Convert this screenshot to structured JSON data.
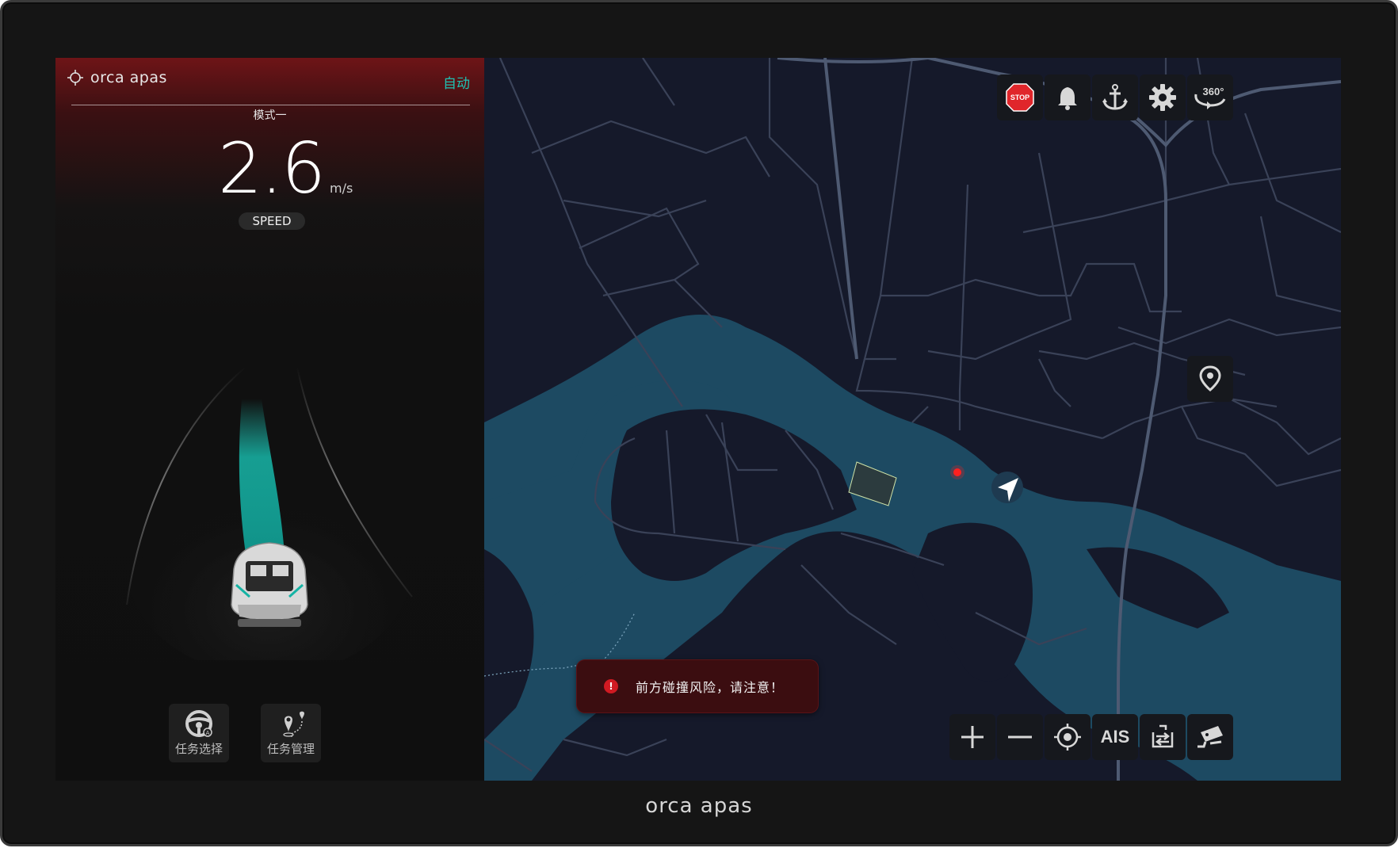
{
  "app": {
    "brand": "orca apas"
  },
  "status": {
    "drive_mode": "自动",
    "mode_name": "模式一"
  },
  "speed": {
    "value": "2.6",
    "unit": "m/s",
    "label": "SPEED"
  },
  "tasks": [
    {
      "label": "任务选择",
      "icon": "steering-wheel-icon"
    },
    {
      "label": "任务管理",
      "icon": "route-pin-icon"
    }
  ],
  "top_tools": [
    {
      "name": "stop-button",
      "icon": "stop-icon",
      "text": "STOP"
    },
    {
      "name": "alarm-button",
      "icon": "bell-icon"
    },
    {
      "name": "anchor-button",
      "icon": "anchor-icon"
    },
    {
      "name": "settings-button",
      "icon": "gear-icon"
    },
    {
      "name": "view-360-button",
      "icon": "rotate-360-icon",
      "text": "360°"
    }
  ],
  "bottom_tools": [
    {
      "name": "zoom-in-button",
      "icon": "plus-icon"
    },
    {
      "name": "zoom-out-button",
      "icon": "minus-icon"
    },
    {
      "name": "locate-button",
      "icon": "crosshair-icon"
    },
    {
      "name": "ais-button",
      "text": "AIS"
    },
    {
      "name": "switch-view-button",
      "icon": "swap-icon"
    },
    {
      "name": "camera-button",
      "icon": "camera-icon"
    }
  ],
  "alert": {
    "message": "前方碰撞风险，请注意！"
  },
  "colors": {
    "accent": "#1fc2b3",
    "water": "#1d4a62",
    "land": "#15192a",
    "road": "#3a4258",
    "alert": "#3b0d10",
    "stop": "#e0262b"
  }
}
